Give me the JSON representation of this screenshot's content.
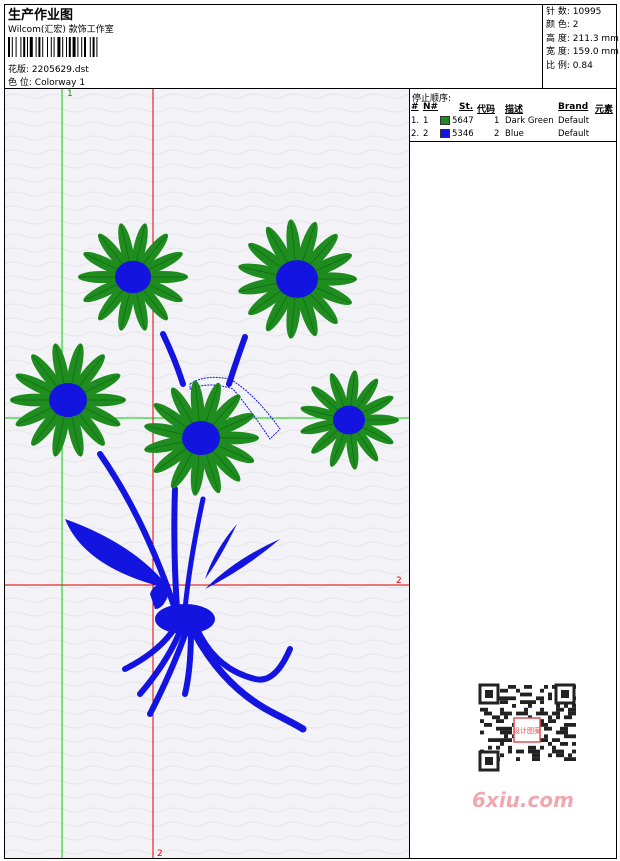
{
  "header": {
    "title": "生产作业图",
    "studio": "Wilcom(汇宏)  款饰工作室",
    "design_label": "花版:",
    "design_file": "2205629.dst",
    "color_label": "色 位:",
    "colorway": "Colorway 1"
  },
  "stats": [
    {
      "label": "针 数:",
      "value": "10995"
    },
    {
      "label": "颜 色:",
      "value": "2"
    },
    {
      "label": "高 度:",
      "value": "211.3 mm"
    },
    {
      "label": "宽 度:",
      "value": "159.0 mm"
    },
    {
      "label": "比 例:",
      "value": "0.84"
    }
  ],
  "stop_sequence": {
    "title": "停止顺序:",
    "columns": [
      "#",
      "N#",
      "St.",
      "代码",
      "描述",
      "Brand",
      "元素"
    ],
    "rows": [
      {
        "num": "1.",
        "n": "1",
        "swatch": "#1e8c1e",
        "stitches": "5647",
        "code": "1",
        "description": "Dark Green",
        "brand": "Default",
        "element": ""
      },
      {
        "num": "2.",
        "n": "2",
        "swatch": "#1414e0",
        "stitches": "5346",
        "code": "2",
        "description": "Blue",
        "brand": "Default",
        "element": ""
      }
    ]
  },
  "canvas": {
    "axis_top_label": "1",
    "axis_right_label": "2",
    "axis_bottom_label": "2",
    "green_color": "#1e8c1e",
    "blue_color": "#1414e0"
  },
  "watermark": {
    "text": "6xiu.com",
    "qr_center": "设计图案"
  }
}
